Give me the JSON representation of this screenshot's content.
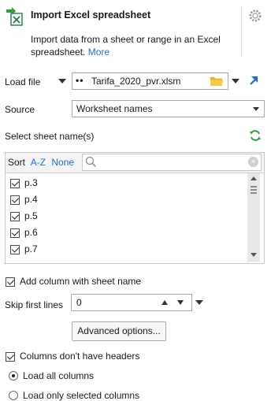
{
  "header": {
    "title": "Import Excel spreadsheet",
    "description": "Import data from a sheet or range in an Excel spreadsheet.",
    "more_link": "More"
  },
  "load_file": {
    "label": "Load file",
    "prefix": "••",
    "filename": "Tarifa_2020_pvr.xlsm"
  },
  "source": {
    "label": "Source",
    "value": "Worksheet names"
  },
  "select_sheets": {
    "label": "Select sheet name(s)",
    "sort_label": "Sort",
    "sort_az": "A-Z",
    "sort_none": "None",
    "search_placeholder": "",
    "items": [
      {
        "label": "p.3",
        "checked": true
      },
      {
        "label": "p.4",
        "checked": true
      },
      {
        "label": "p.5",
        "checked": true
      },
      {
        "label": "p.6",
        "checked": true
      },
      {
        "label": "p.7",
        "checked": true
      }
    ]
  },
  "add_column": {
    "label": "Add column with sheet name",
    "checked": true
  },
  "skip_lines": {
    "label": "Skip first lines",
    "value": "0"
  },
  "advanced_button": "Advanced options...",
  "no_headers": {
    "label": "Columns don't have headers",
    "checked": true
  },
  "load_options": [
    {
      "label": "Load all columns",
      "selected": true
    },
    {
      "label": "Load only selected columns",
      "selected": false
    }
  ],
  "colors": {
    "accent": "#1f6fd1",
    "excel_green": "#1e7b45",
    "refresh_green": "#2e9e3e",
    "folder": "#f0b429"
  }
}
